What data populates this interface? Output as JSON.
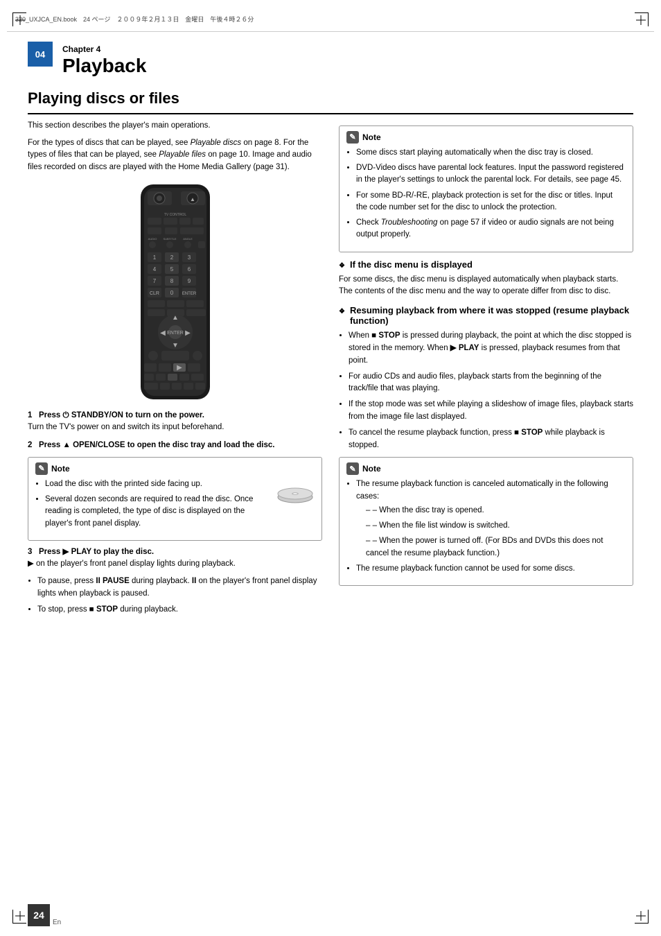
{
  "header": {
    "text": "320_UXJCA_EN.book　24 ページ　２００９年２月１３日　金曜日　午後４時２６分"
  },
  "chapter": {
    "num": "04",
    "label": "Chapter 4",
    "title": "Playback"
  },
  "section": {
    "title": "Playing discs or files"
  },
  "intro": {
    "p1": "This section describes the player's main operations.",
    "p2": "For the types of discs that can be played, see Playable discs on page 8. For the types of files that can be played, see Playable files on page 10. Image and audio files recorded on discs are played with the Home Media Gallery (page 31)."
  },
  "steps": {
    "step1_label": "1",
    "step1_text": "Press",
    "step1_bold": "STANDBY/ON to turn on the power.",
    "step1_sub": "Turn the TV's power on and switch its input beforehand.",
    "step2_label": "2",
    "step2_text": "Press",
    "step2_bold": "OPEN/CLOSE to open the disc tray and load the disc."
  },
  "note1": {
    "label": "Note",
    "bullets": [
      "Load the disc with the printed side facing up.",
      "Several dozen seconds are required to read the disc. Once reading is completed, the type of disc is displayed on the player's front panel display."
    ]
  },
  "step3": {
    "label": "3",
    "text": "Press",
    "bold": "PLAY to play the disc.",
    "sub1_pre": "▶ on the player's front panel display lights during playback.",
    "sub2_pre": "• To pause, press",
    "sub2_bold": "II PAUSE",
    "sub2_mid": " during playback.",
    "sub2_bold2": "II",
    "sub2_end": " on the player's front panel display lights when playback is paused.",
    "sub3_pre": "• To stop, press",
    "sub3_bold": "■ STOP",
    "sub3_end": " during playback."
  },
  "right_note1": {
    "label": "Note",
    "bullets": [
      "Some discs start playing automatically when the disc tray is closed.",
      "DVD-Video discs have parental lock features. Input the password registered in the player's settings to unlock the parental lock. For details, see page 45.",
      "For some BD-R/-RE, playback protection is set for the disc or titles. Input the code number set for the disc to unlock the protection.",
      "Check Troubleshooting on page 57 if video or audio signals are not being output properly."
    ]
  },
  "subsec1": {
    "diamond": "❖",
    "title": "If the disc menu is displayed",
    "text": "For some discs, the disc menu is displayed automatically when playback starts. The contents of the disc menu and the way to operate differ from disc to disc."
  },
  "subsec2": {
    "diamond": "❖",
    "title": "Resuming playback from where it was stopped (resume playback function)",
    "bullets": [
      "When ■ STOP is pressed during playback, the point at which the disc stopped is stored in the memory. When ▶ PLAY is pressed, playback resumes from that point.",
      "For audio CDs and audio files, playback starts from the beginning of the track/file that was playing.",
      "If the stop mode was set while playing a slideshow of image files, playback starts from the image file last displayed.",
      "To cancel the resume playback function, press ■ STOP while playback is stopped."
    ]
  },
  "right_note2": {
    "label": "Note",
    "bullets": [
      "The resume playback function is canceled automatically in the following cases:",
      "The resume playback function cannot be used for some discs."
    ],
    "sub_bullets": [
      "When the disc tray is opened.",
      "When the file list window is switched.",
      "When the power is turned off. (For BDs and DVDs this does not cancel the resume playback function.)"
    ]
  },
  "footer": {
    "page_num": "24",
    "lang": "En"
  }
}
